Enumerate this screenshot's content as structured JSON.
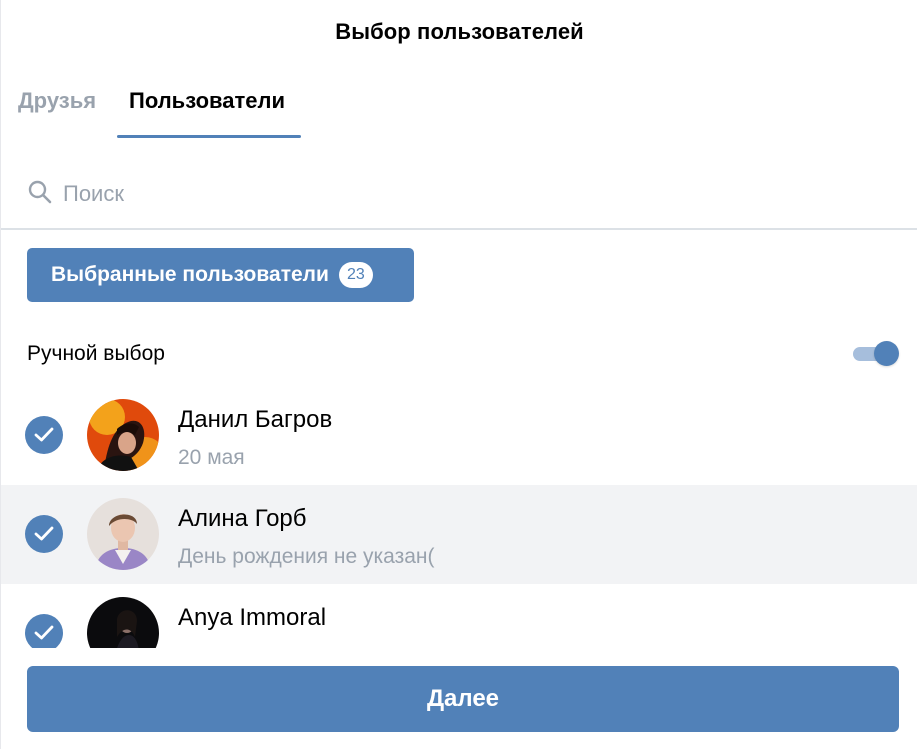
{
  "header": {
    "title": "Выбор пользователей"
  },
  "tabs": [
    {
      "label": "Друзья",
      "active": false
    },
    {
      "label": "Пользователи",
      "active": true
    }
  ],
  "search": {
    "placeholder": "Поиск",
    "value": "",
    "icon": "search-icon"
  },
  "selected_button": {
    "label": "Выбранные пользователи",
    "count": "23"
  },
  "manual_selection": {
    "label": "Ручной выбор",
    "enabled": true
  },
  "users": [
    {
      "name": "Данил Багров",
      "subtitle": "20 мая",
      "checked": true,
      "highlighted": false
    },
    {
      "name": "Алина Горб",
      "subtitle": "День рождения не указан(",
      "checked": true,
      "highlighted": true
    },
    {
      "name": "Anya Immoral",
      "subtitle": "",
      "checked": true,
      "highlighted": false
    }
  ],
  "next_button": {
    "label": "Далее"
  },
  "colors": {
    "accent": "#5181b8",
    "muted_text": "#99a2ad",
    "highlight_row": "#f2f3f5",
    "toggle_track": "#a6bedc",
    "divider": "#dce1e6"
  }
}
